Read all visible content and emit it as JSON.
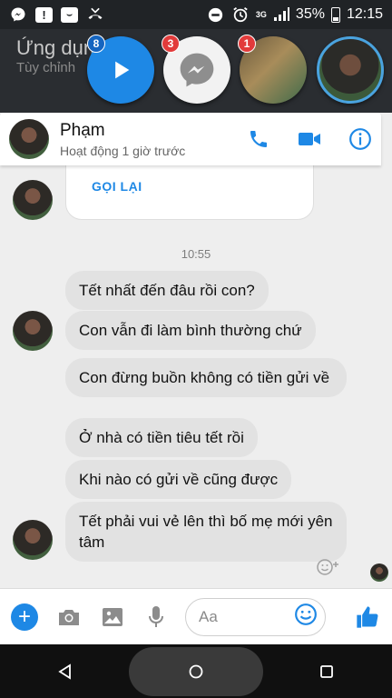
{
  "status_bar": {
    "network": "3G",
    "battery": "35%",
    "time": "12:15"
  },
  "backdrop": {
    "app_title": "Ứng dụng",
    "app_subtitle": "Tùy chỉnh"
  },
  "chat_heads": [
    {
      "name": "play",
      "badge": "8"
    },
    {
      "name": "messenger",
      "badge": "3"
    },
    {
      "name": "photo",
      "badge": "1"
    },
    {
      "name": "contact",
      "badge": ""
    }
  ],
  "header": {
    "contact_name": "Phạm",
    "status": "Hoạt động 1 giờ trước"
  },
  "call_card": {
    "action_label": "GỌI LẠI"
  },
  "conversation": {
    "timestamp": "10:55",
    "messages": [
      "Tết nhất đến đâu rồi con?",
      "Con vẫn đi làm bình thường chứ",
      "Con đừng buồn không có tiền gửi về",
      "Ở nhà có tiền tiêu tết rồi",
      "Khi nào có gửi về cũng được",
      "Tết phải vui vẻ lên thì bố mẹ mới yên tâm"
    ]
  },
  "composer": {
    "placeholder": "Aa"
  },
  "colors": {
    "accent": "#1e88e5",
    "bubble": "#e2e2e2",
    "badge": "#e23b3b"
  }
}
